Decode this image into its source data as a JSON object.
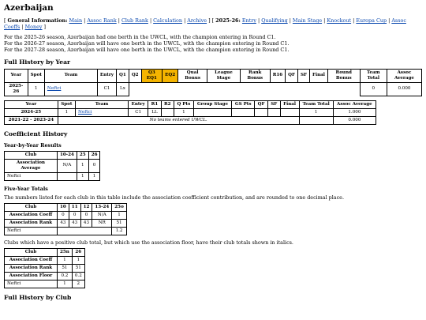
{
  "title": "Azerbaijan",
  "nav": {
    "general_label": "General Information:",
    "general_links": [
      "Main",
      "Assoc Rank",
      "Club Rank",
      "Calculation",
      "Archive"
    ],
    "season_label": "2025-26",
    "season_links": [
      "Entry",
      "Qualifying",
      "Main Stage",
      "Knockout",
      "Europa Cup",
      "Assoc Coeffs",
      "Money"
    ]
  },
  "intro": [
    "For the 2025-26 season, Azerbaijan had one berth in the UWCL, with the champion entering in Round C1.",
    "For the 2026-27 season, Azerbaijan will have one berth in the UWCL, with the champion entering in Round C1.",
    "For the 2027-28 season, Azerbaijan will have one berth in the UWCL, with the champion entering in Round C1."
  ],
  "full_history_year": {
    "heading": "Full History by Year",
    "table1": {
      "headers": [
        "Year",
        "Spot",
        "Team",
        "Entry",
        "Q1",
        "Q2",
        "Q3 EQ1",
        "EQ2",
        "Qual Bonus",
        "League Stage",
        "Rank Bonus",
        "R16",
        "QF",
        "SF",
        "Final",
        "Round Bonus",
        "Team Total",
        "Assoc Average"
      ],
      "row": {
        "year": "2025-26",
        "spot": "1",
        "team": "Neftci",
        "entry": "C1",
        "q1": "Lx",
        "team_total": "0",
        "assoc_average": "0.000"
      }
    },
    "table2": {
      "headers": [
        "Year",
        "Spot",
        "Team",
        "Entry",
        "R1",
        "R2",
        "Q Pts",
        "Group Stage",
        "GS Pts",
        "QF",
        "SF",
        "Final",
        "Team Total",
        "Assoc Average"
      ],
      "row1": {
        "year": "2024-25",
        "spot": "1",
        "team": "Neftci",
        "entry": "C1",
        "r1": "LL",
        "q_pts": "1",
        "team_total": "1",
        "assoc_average": "1.000"
      },
      "row2": {
        "year": "2021-22 - 2023-24",
        "note": "No teams entered UWCL.",
        "assoc_average": "0.000"
      }
    }
  },
  "coeff": {
    "heading": "Coefficient History",
    "yby": {
      "heading": "Year-by-Year Results",
      "headers": [
        "Club",
        "10-24",
        "25",
        "26"
      ],
      "rows": [
        [
          "Association Average",
          "N/A",
          "1",
          "0"
        ],
        [
          "Neftci",
          "",
          "1",
          "1"
        ]
      ]
    },
    "five": {
      "heading": "Five-Year Totals",
      "note": "The numbers listed for each club in this table include the association coefficient contribution, and are rounded to one decimal place.",
      "headers": [
        "Club",
        "10",
        "11",
        "12",
        "13-24",
        "25o"
      ],
      "rows": [
        [
          "Association Coeff",
          "0",
          "0",
          "0",
          "N/A",
          "1"
        ],
        [
          "Association Rank",
          "43",
          "43",
          "43",
          "NR",
          "51"
        ],
        [
          "Neftci",
          "",
          "",
          "",
          "",
          "1.2"
        ]
      ]
    },
    "floor_note": "Clubs which have a positive club total, but which use the association floor, have their club totals shown in italics.",
    "t3": {
      "headers": [
        "Club",
        "25n",
        "26"
      ],
      "rows": [
        [
          "Association Coeff",
          "1",
          "1"
        ],
        [
          "Association Rank",
          "51",
          "51"
        ],
        [
          "Association Floor",
          "0.2",
          "0.2"
        ],
        [
          "Neftci",
          "1",
          "2"
        ]
      ]
    }
  },
  "full_history_club": {
    "heading": "Full History by Club"
  },
  "colors": {
    "highlight": "#f4b400",
    "link": "#0645ad"
  }
}
